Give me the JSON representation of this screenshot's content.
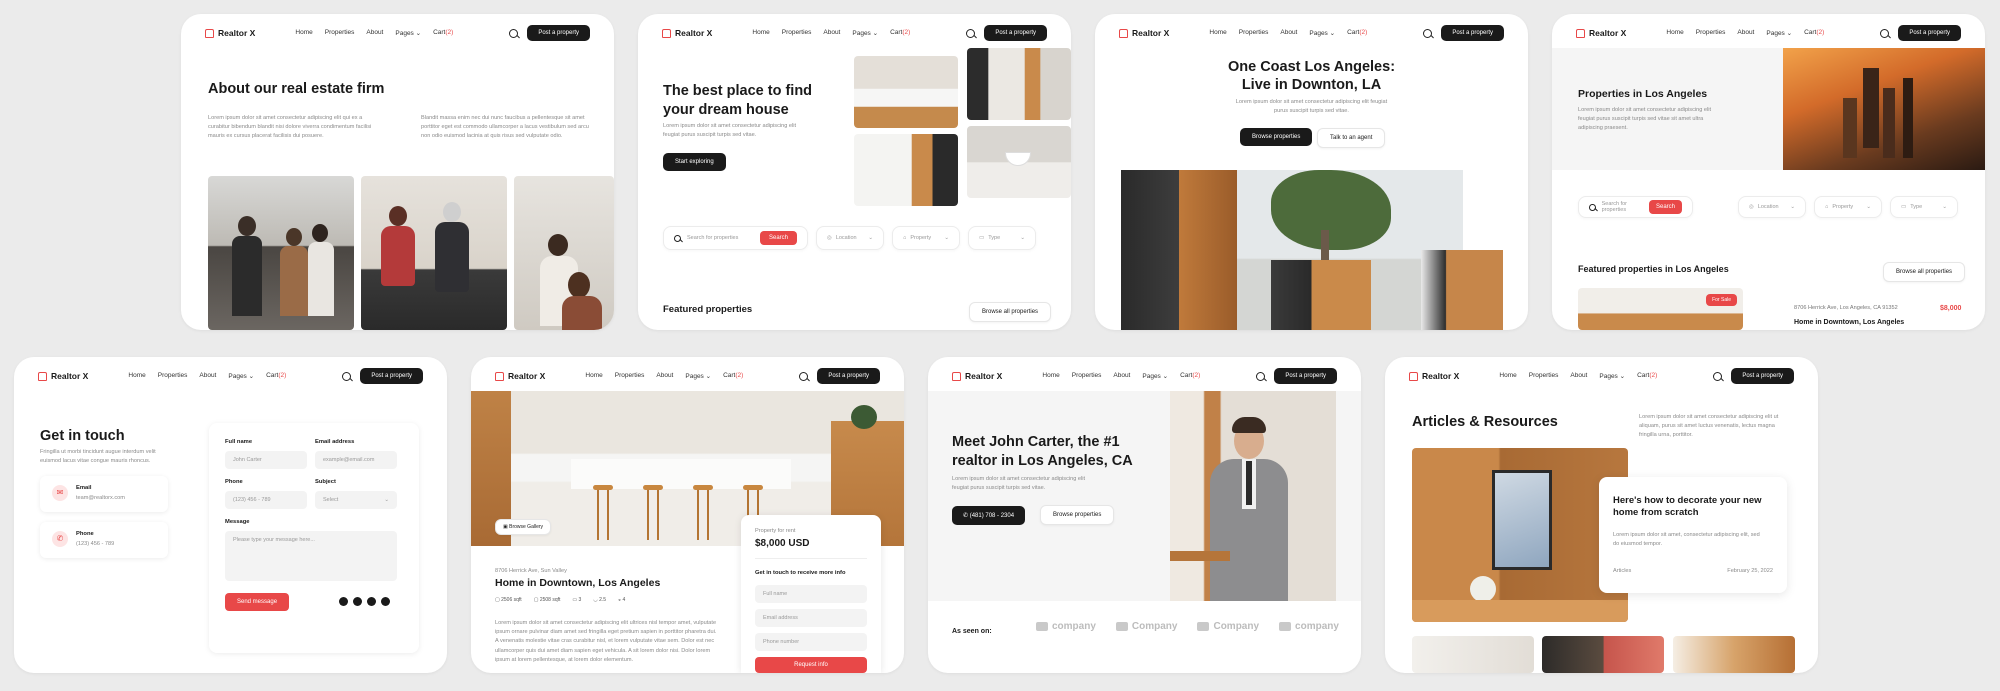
{
  "nav": {
    "logo": "Realtor X",
    "links": [
      "Home",
      "Properties",
      "About",
      "Pages",
      "Cart"
    ],
    "pages_caret": "⌄",
    "cart_count": "(2)",
    "cta": "Post a property"
  },
  "about": {
    "title": "About our real estate firm",
    "p1": "Lorem ipsum dolor sit amet consectetur adipiscing elit qui ex a curabitur bibendum blandit nisi dolore viverra condimentum facilisi mauris ex cursus placerat facilisis dui posuere.",
    "p2": "Blandit massa enim nec dui nunc faucibus a pellentesque sit amet porttitor eget est commodo ullamcorper a lacus vestibulum sed arcu non odio euismod lacinia at quis risus sed vulputate odio."
  },
  "hero_home": {
    "title": "The best place to find your dream house",
    "sub": "Lorem ipsum dolor sit amet consectetur adipiscing elit feugiat purus suscipit turpis sed vitae.",
    "cta": "Start exploring",
    "search_placeholder": "Search for properties",
    "search_btn": "Search",
    "location": "Location",
    "property": "Property",
    "type": "Type",
    "featured": "Featured properties",
    "browse": "Browse all properties"
  },
  "coast": {
    "title_line1": "One Coast Los Angeles:",
    "title_line2": "Live in Downton, LA",
    "sub": "Lorem ipsum dolor sit amet consectetur adipiscing elit feugiat purus suscipit turpis sed vitae.",
    "cta1": "Browse properties",
    "cta2": "Talk to an agent"
  },
  "la": {
    "title": "Properties in Los Angeles",
    "sub": "Lorem ipsum dolor sit amet consectetur adipiscing elit feugiat purus suscipit turpis sed vitae sit amet ultra adipiscing praesent.",
    "search_placeholder": "Search for properties",
    "search_btn": "Search",
    "location": "Location",
    "property": "Property",
    "type": "Type",
    "featured": "Featured properties in Los Angeles",
    "browse": "Browse all properties",
    "badge": "For Sale",
    "address": "8706 Herrick Ave, Los Angeles, CA 91352",
    "price": "$8,000",
    "listing": "Home in Downtown, Los Angeles"
  },
  "contact": {
    "title": "Get in touch",
    "sub": "Fringilla ut morbi tincidunt augue interdum velit euismod lacus vitae congue mauris rhoncus.",
    "email_label": "Email",
    "email_value": "team@realtorx.com",
    "phone_label": "Phone",
    "phone_value": "(123) 456 - 789",
    "full_name": "Full name",
    "full_name_ph": "John Carter",
    "email_address": "Email address",
    "email_ph": "example@email.com",
    "phone": "Phone",
    "phone_ph": "(123) 456 - 789",
    "subject": "Subject",
    "subject_ph": "Select",
    "message": "Message",
    "message_ph": "Please type your message here...",
    "send": "Send message"
  },
  "listing": {
    "gallery": "Browse Gallery",
    "address": "8706 Herrick Ave, Sun Valley",
    "title": "Home in Downtown, Los Angeles",
    "stats": [
      "2506 sqft",
      "2508 sqft",
      "3",
      "2.5",
      "4"
    ],
    "desc": "Lorem ipsum dolor sit amet consectetur adipiscing elit ultrices nisl tempor amet, vulputate ipsum ornare pulvinar diam amet sed fringilla eget pretium sapien in porttitor pharetra dui. A venenatis molestie vitae cras curabitur nisl, et lorem vulputate vitae sem. Dolor est nec ullamcorper quis dui amet diam sapien eget vehicula. A sit lorem dolor nisi. Dolor lorem ipsum at lorem pellentesque, at lorem dolor elementum.",
    "for_rent": "Property for rent",
    "price": "$8,000 USD",
    "more_info": "Get in touch to receive more info",
    "fn": "Full name",
    "em": "Email address",
    "ph": "Phone number",
    "request": "Request info"
  },
  "agent": {
    "title": "Meet John Carter, the #1 realtor in Los Angeles, CA",
    "sub": "Lorem ipsum dolor sit amet consectetur adipiscing elit feugiat purus suscipit turpis sed vitae.",
    "phone": "(481) 708 - 2304",
    "browse": "Browse properties",
    "seen_on": "As seen on:",
    "logos": [
      "company",
      "Company",
      "Company",
      "company"
    ]
  },
  "articles": {
    "title": "Articles & Resources",
    "sub": "Lorem ipsum dolor sit amet consectetur adipiscing elit ut aliquam, purus sit amet luctus venenatis, lectus magna fringilla urna, porttitor.",
    "card_title": "Here's how to decorate your new home from scratch",
    "card_sub": "Lorem ipsum dolor sit amet, consectetur adipiscing elit, sed do eiusmod tempor.",
    "category": "Articles",
    "date": "February 25, 2022"
  },
  "colors": {
    "accent": "#e84848",
    "dark": "#1a1a1a",
    "bg": "#ebebeb"
  }
}
